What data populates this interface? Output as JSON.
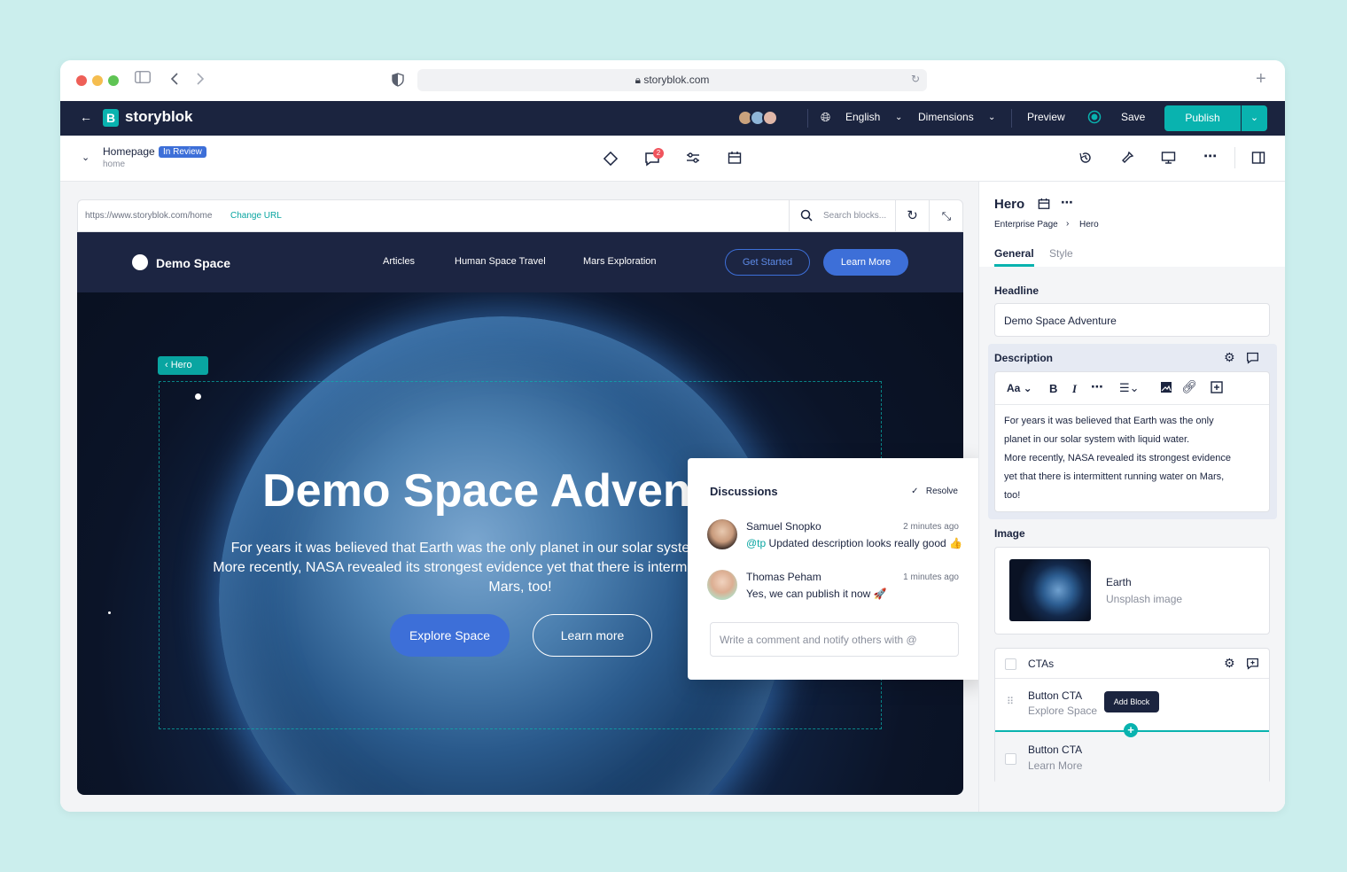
{
  "browser": {
    "url": "storyblok.com"
  },
  "appbar": {
    "brand": "storyblok",
    "language": "English",
    "dimensions": "Dimensions",
    "preview": "Preview",
    "save": "Save",
    "publish": "Publish"
  },
  "toolbar": {
    "page_name": "Homepage",
    "status": "In Review",
    "slug": "home",
    "comment_count": "2"
  },
  "preview": {
    "url": "https://www.storyblok.com/home",
    "change_url": "Change URL",
    "search_placeholder": "Search blocks..."
  },
  "site": {
    "brand": "Demo Space",
    "nav": [
      "Articles",
      "Human Space Travel",
      "Mars Exploration"
    ],
    "get_started": "Get Started",
    "learn_more_nav": "Learn More",
    "hero_tag": "Hero",
    "headline": "Demo Space Adventure",
    "description_line1": "For years it was believed that Earth was the only planet in our solar system with liquid water.",
    "description_line2": "More recently, NASA revealed its strongest evidence yet that there is intermittent running water on Mars, too!",
    "cta_explore": "Explore Space",
    "cta_learn": "Learn more"
  },
  "discussions": {
    "title": "Discussions",
    "resolve": "Resolve",
    "comments": [
      {
        "name": "Samuel Snopko",
        "time": "2 minutes ago",
        "mention": "@tp",
        "text": "Updated description looks really good 👍"
      },
      {
        "name": "Thomas Peham",
        "time": "1 minutes ago",
        "mention": "",
        "text": "Yes, we can publish it now 🚀"
      }
    ],
    "input_placeholder": "Write a comment and notify others with @"
  },
  "panel": {
    "title": "Hero",
    "breadcrumb_parent": "Enterprise Page",
    "breadcrumb_current": "Hero",
    "tab_general": "General",
    "tab_style": "Style",
    "headline_label": "Headline",
    "headline_value": "Demo Space Adventure",
    "description_label": "Description",
    "rte_font": "Aa",
    "description_lines": [
      "For years it was believed that Earth was the only",
      "planet in our solar system with liquid water.",
      "More recently, NASA revealed its strongest evidence",
      "yet that there is intermittent running water on Mars,",
      "too!"
    ],
    "image_label": "Image",
    "image_name": "Earth",
    "image_source": "Unsplash image",
    "ctas_label": "CTAs",
    "cta_items": [
      {
        "type": "Button CTA",
        "label": "Explore Space"
      },
      {
        "type": "Button CTA",
        "label": "Learn More"
      }
    ],
    "add_block_tooltip": "Add Block"
  },
  "colors": {
    "navy": "#1b243f",
    "teal": "#09b3af",
    "blue": "#3d6fd8",
    "background": "#cbeeed"
  }
}
